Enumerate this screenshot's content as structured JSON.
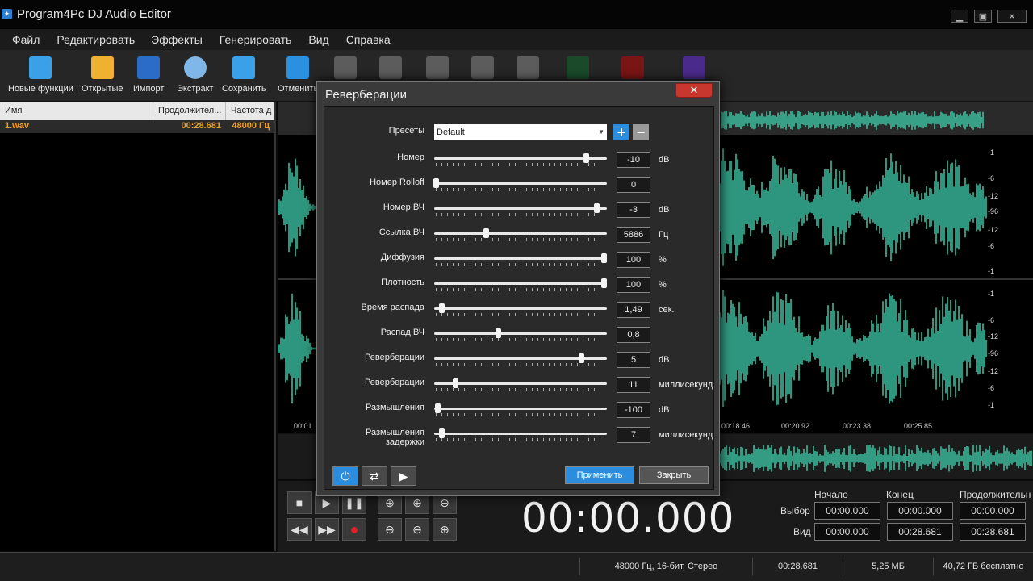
{
  "window": {
    "title": "Program4Pc DJ Audio Editor",
    "minimize": "▁",
    "maximize": "▣",
    "close": "✕"
  },
  "menu": [
    "Файл",
    "Редактировать",
    "Эффекты",
    "Генерировать",
    "Вид",
    "Справка"
  ],
  "toolbar": [
    {
      "label": "Новые функции",
      "icon": "new-features-icon",
      "color": "#3aa0e8"
    },
    {
      "label": "Открытые",
      "icon": "folder-icon",
      "color": "#f0b030"
    },
    {
      "label": "Импорт",
      "icon": "film-icon",
      "color": "#2a6cc8"
    },
    {
      "label": "Экстракт",
      "icon": "disc-icon",
      "color": "#7fb7e8"
    },
    {
      "label": "Сохранить",
      "icon": "save-icon",
      "color": "#3aa0e8"
    },
    {
      "label": "Отменить",
      "icon": "undo-icon",
      "color": "#2a90e0"
    }
  ],
  "file_list": {
    "headers": [
      "Имя",
      "Продолжител...",
      "Частота д"
    ],
    "rows": [
      {
        "name": "1.wav",
        "duration": "00:28.681",
        "rate": "48000 Гц"
      }
    ]
  },
  "ruler": [
    "00:01.",
    "00:18.46",
    "00:20.92",
    "00:23.38",
    "00:25.85"
  ],
  "db_scale": [
    "-1",
    "-6",
    "-12",
    "-96",
    "-12",
    "-6",
    "-1",
    "-1",
    "-6",
    "-12",
    "-96",
    "-12",
    "-6",
    "-1"
  ],
  "timecode": "00:00.000",
  "selection": {
    "headers": [
      "Начало",
      "Конец",
      "Продолжительн"
    ],
    "rows": [
      {
        "label": "Выбор",
        "values": [
          "00:00.000",
          "00:00.000",
          "00:00.000"
        ]
      },
      {
        "label": "Вид",
        "values": [
          "00:00.000",
          "00:28.681",
          "00:28.681"
        ]
      }
    ]
  },
  "status": [
    "48000 Гц, 16-бит, Стерео",
    "00:28.681",
    "5,25 МБ",
    "40,72 ГБ бесплатно"
  ],
  "dialog": {
    "title": "Реверберации",
    "close": "✕",
    "preset_label": "Пресеты",
    "preset_value": "Default",
    "add": "+",
    "remove": "−",
    "params": [
      {
        "label": "Номер",
        "value": "-10",
        "unit": "dB",
        "level": 0.88
      },
      {
        "label": "Номер Rolloff",
        "value": "0",
        "unit": "",
        "level": 0.01
      },
      {
        "label": "Номер ВЧ",
        "value": "-3",
        "unit": "dB",
        "level": 0.94
      },
      {
        "label": "Ссылка ВЧ",
        "value": "5886",
        "unit": "Гц",
        "level": 0.3
      },
      {
        "label": "Диффузия",
        "value": "100",
        "unit": "%",
        "level": 0.98
      },
      {
        "label": "Плотность",
        "value": "100",
        "unit": "%",
        "level": 0.98
      },
      {
        "label": "Время распада",
        "value": "1,49",
        "unit": "сек.",
        "level": 0.04
      },
      {
        "label": "Распад ВЧ",
        "value": "0,8",
        "unit": "",
        "level": 0.37
      },
      {
        "label": "Реверберации",
        "value": "5",
        "unit": "dB",
        "level": 0.85
      },
      {
        "label": "Реверберации",
        "value": "11",
        "unit": "миллисекунд",
        "level": 0.12
      },
      {
        "label": "Размышления",
        "value": "-100",
        "unit": "dB",
        "level": 0.02
      },
      {
        "label": "Размышления задержки",
        "value": "7",
        "unit": "миллисекунд",
        "level": 0.04
      }
    ],
    "apply": "Применить",
    "close_btn": "Закрыть"
  },
  "colors": {
    "wave": "#3ec8a8",
    "accent": "#2b8de0",
    "close": "#c8372d"
  }
}
